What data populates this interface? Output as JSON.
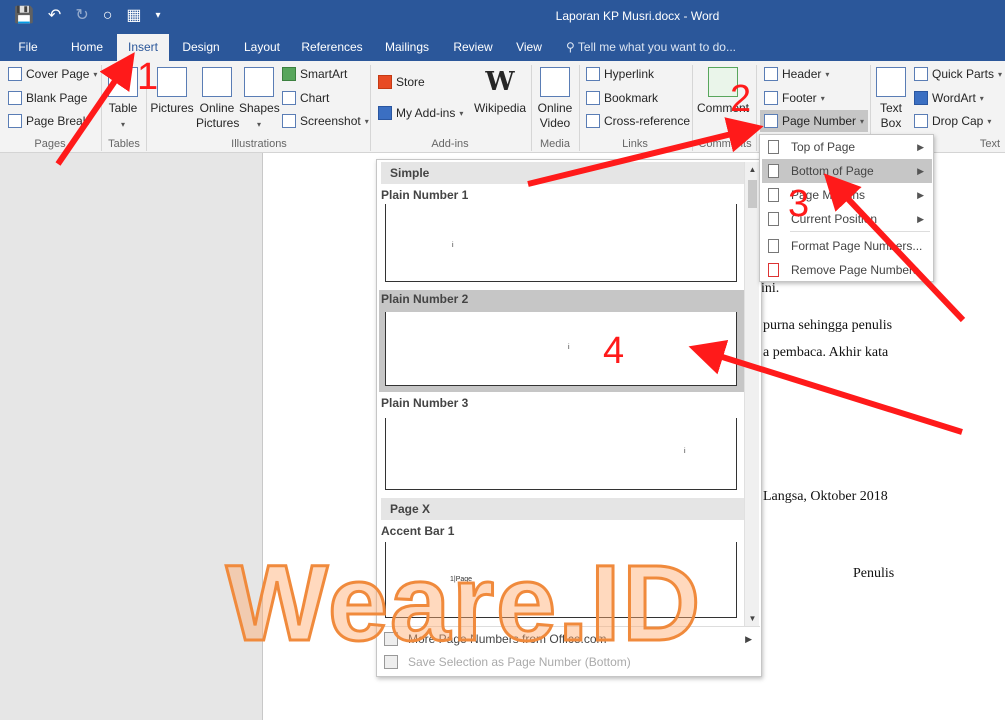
{
  "window": {
    "title": "Laporan KP Musri.docx - Word"
  },
  "tabs": [
    "File",
    "Home",
    "Insert",
    "Design",
    "Layout",
    "References",
    "Mailings",
    "Review",
    "View"
  ],
  "tell_me": "Tell me what you want to do...",
  "ribbon": {
    "pages": {
      "label": "Pages",
      "cover_page": "Cover Page",
      "blank_page": "Blank Page",
      "page_break": "Page Break"
    },
    "tables": {
      "label": "Tables",
      "table": "Table"
    },
    "illustrations": {
      "label": "Illustrations",
      "pictures": "Pictures",
      "online_pictures": "Online\nPictures",
      "shapes": "Shapes",
      "smartart": "SmartArt",
      "chart": "Chart",
      "screenshot": "Screenshot"
    },
    "addins": {
      "label": "Add-ins",
      "store": "Store",
      "my_addins": "My Add-ins",
      "wikipedia": "Wikipedia",
      "wiki_logo": "W"
    },
    "media": {
      "label": "Media",
      "online_video": "Online\nVideo"
    },
    "links": {
      "label": "Links",
      "hyperlink": "Hyperlink",
      "bookmark": "Bookmark",
      "cross_reference": "Cross-reference"
    },
    "comments": {
      "label": "Comments",
      "comment": "Comment"
    },
    "header_footer": {
      "header": "Header",
      "footer": "Footer",
      "page_number": "Page Number"
    },
    "text": {
      "label": "Text",
      "text_box": "Text\nBox",
      "quick_parts": "Quick Parts",
      "wordart": "WordArt",
      "drop_cap": "Drop Cap"
    }
  },
  "page_number_menu": {
    "items": [
      "Top of Page",
      "Bottom of Page",
      "Page Margins",
      "Current Position",
      "Format Page Numbers...",
      "Remove Page Numbers"
    ]
  },
  "gallery": {
    "section_simple": "Simple",
    "plain1": "Plain Number 1",
    "plain2": "Plain Number 2",
    "plain3": "Plain Number 3",
    "section_pagex": "Page X",
    "accent1": "Accent Bar 1",
    "accent1_text": "1|Page",
    "num_i": "i",
    "more": "More Page Numbers from Office.com",
    "save_selection": "Save Selection as Page Number (Bottom)"
  },
  "document": {
    "line1": "ini.",
    "line2": "purna sehingga penulis",
    "line3": "a pembaca. Akhir kata",
    "line4": "Langsa, Oktober 2018",
    "line5": "Penulis"
  },
  "annotations": {
    "n1": "1",
    "n2": "2",
    "n3": "3",
    "n4": "4",
    "watermark": "Weare.ID"
  },
  "colors": {
    "ribbon_blue": "#2b579a",
    "annotation_red": "#ff1a1a",
    "watermark_orange": "#f08a3c"
  }
}
